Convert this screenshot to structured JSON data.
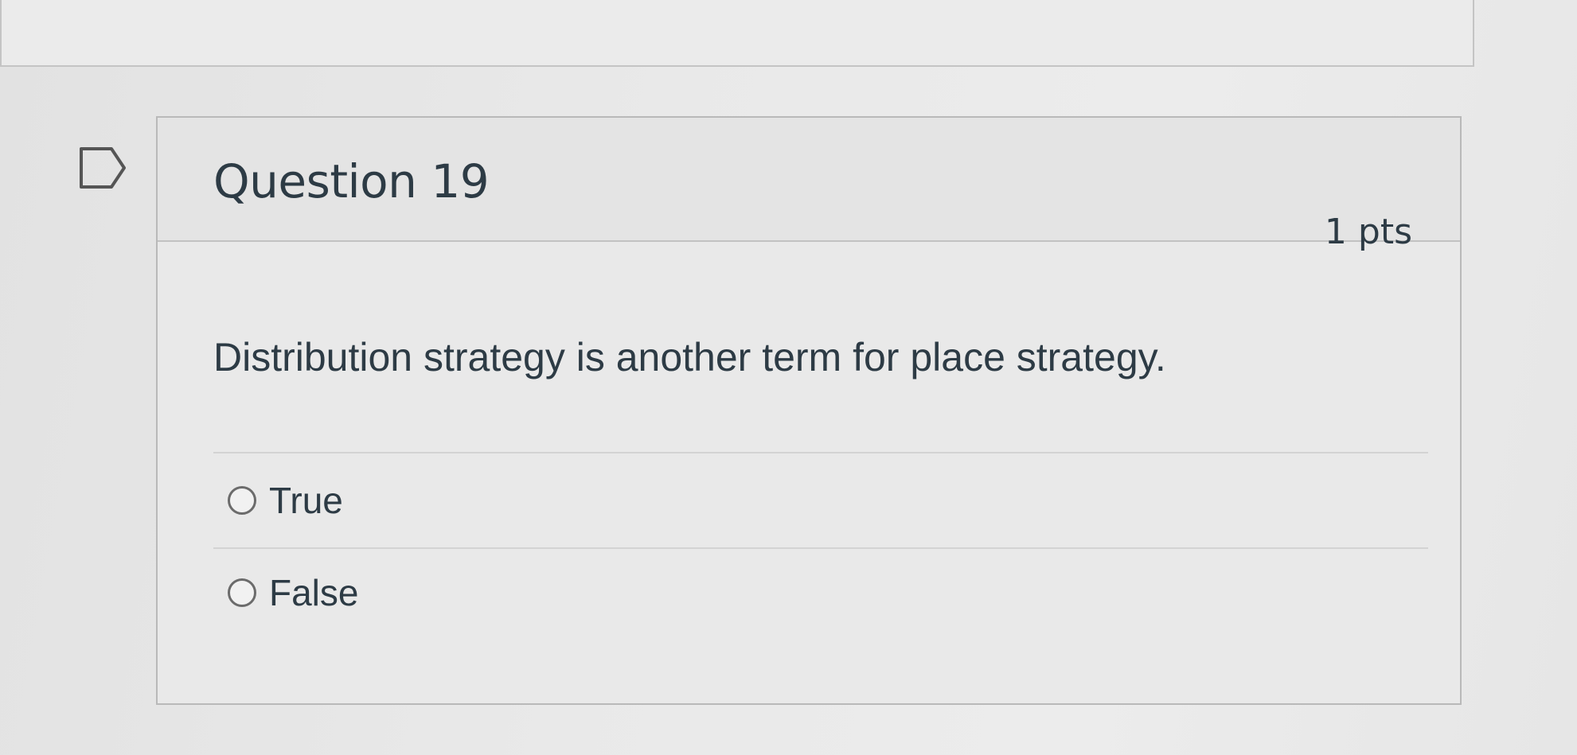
{
  "question": {
    "title": "Question 19",
    "points": "1 pts",
    "text": "Distribution strategy is another term for place strategy.",
    "answers": [
      {
        "label": "True",
        "selected": false
      },
      {
        "label": "False",
        "selected": false
      }
    ]
  },
  "icons": {
    "flag": "flag-question-icon",
    "radio": "radio-unselected-icon"
  },
  "colors": {
    "text": "#2d3b45",
    "border": "#b9b9b9"
  }
}
